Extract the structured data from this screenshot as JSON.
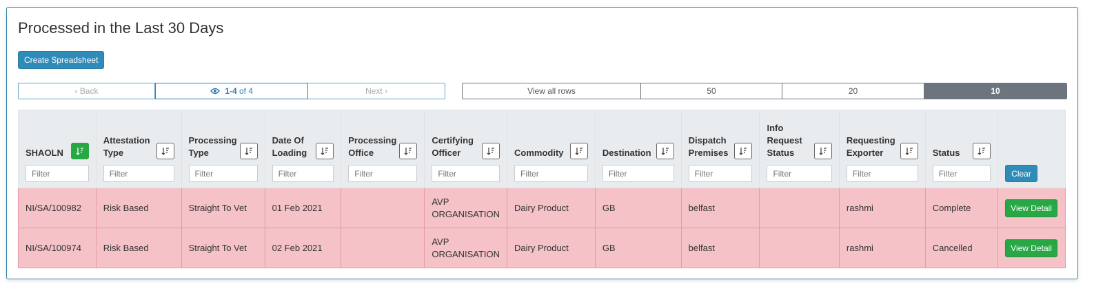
{
  "page": {
    "title": "Processed in the Last 30 Days"
  },
  "toolbar": {
    "create_label": "Create Spreadsheet"
  },
  "pager": {
    "back_label": "Back",
    "range": "1-4",
    "of_text": "of 4",
    "next_label": "Next"
  },
  "rows_per_page": {
    "options": [
      "View all rows",
      "50",
      "20",
      "10"
    ],
    "selected": "10"
  },
  "table": {
    "columns": [
      {
        "key": "shaoln",
        "label": "SHAOLN",
        "filter_placeholder": "Filter",
        "sort_active": true
      },
      {
        "key": "attestation_type",
        "label": "Attestation Type",
        "filter_placeholder": "Filter"
      },
      {
        "key": "processing_type",
        "label": "Processing Type",
        "filter_placeholder": "Filter"
      },
      {
        "key": "date_of_loading",
        "label": "Date Of Loading",
        "filter_placeholder": "Filter"
      },
      {
        "key": "processing_office",
        "label": "Processing Office",
        "filter_placeholder": "Filter"
      },
      {
        "key": "certifying_officer",
        "label": "Certifying Officer",
        "filter_placeholder": "Filter"
      },
      {
        "key": "commodity",
        "label": "Commodity",
        "filter_placeholder": "Filter"
      },
      {
        "key": "destination",
        "label": "Destination",
        "filter_placeholder": "Filter"
      },
      {
        "key": "dispatch_premises",
        "label": "Dispatch Premises",
        "filter_placeholder": "Filter"
      },
      {
        "key": "info_request_status",
        "label": "Info Request Status",
        "filter_placeholder": "Filter"
      },
      {
        "key": "requesting_exporter",
        "label": "Requesting Exporter",
        "filter_placeholder": "Filter"
      },
      {
        "key": "status",
        "label": "Status",
        "filter_placeholder": "Filter"
      }
    ],
    "clear_label": "Clear",
    "action_label": "View Detail",
    "rows": [
      [
        "NI/SA/100982",
        "Risk Based",
        "Straight To Vet",
        "01 Feb 2021",
        "",
        "AVP ORGANISATION",
        "Dairy Product",
        "GB",
        "belfast",
        "",
        "rashmi",
        "Complete"
      ],
      [
        "NI/SA/100974",
        "Risk Based",
        "Straight To Vet",
        "02 Feb 2021",
        "",
        "AVP ORGANISATION",
        "Dairy Product",
        "GB",
        "belfast",
        "",
        "rashmi",
        "Cancelled"
      ]
    ]
  },
  "colors": {
    "primary": "#2f8bb8",
    "success": "#28a745",
    "row_danger": "#f4c2c7",
    "active_rows": "#6c757d"
  }
}
